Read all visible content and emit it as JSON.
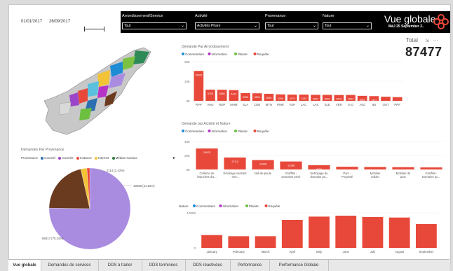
{
  "date_range": {
    "start": "01/01/2017",
    "end": "26/09/2017"
  },
  "filters": [
    {
      "label": "Arrondissement/Service",
      "value": "Tout"
    },
    {
      "label": "Activité",
      "value": "Activités Phare"
    },
    {
      "label": "Provenance",
      "value": "Tout"
    },
    {
      "label": "Nature",
      "value": "Tout"
    }
  ],
  "header": {
    "title": "Vue globale",
    "subtitle": "MàJ 25 September 2.."
  },
  "kpi": {
    "label": "Total",
    "value": "87477"
  },
  "colors": {
    "commentaire": "#1f8dd6",
    "information": "#b533c7",
    "plainte": "#6cbf3f",
    "requete": "#e8483a",
    "courriel": "#2b6fb0",
    "courrier": "#9d45c9",
    "instance": "#e8483a",
    "internet": "#f2c335",
    "medias": "#2d7b3a",
    "telephone": "#a98be0",
    "autre": "#6b3b1f"
  },
  "chart_data": [
    {
      "type": "bar",
      "title": "Demande Par Arrondissement",
      "legend": [
        "Commentaire",
        "Information",
        "Plainte",
        "Requête"
      ],
      "categories": [
        "RPP",
        "AHU",
        "RDP",
        "MHM",
        "SLA",
        "CDN",
        "MTN",
        "PMR",
        "VSP",
        "LAC",
        "LAS",
        "SLE",
        "VER",
        "S-O",
        "ANJ",
        "IBI",
        "OUT",
        "PRF"
      ],
      "values": [
        15263,
        5705,
        5660,
        5474,
        3939,
        3844,
        3594,
        3294,
        3179,
        3182,
        3064,
        3044,
        2976,
        2994,
        2551,
        2401,
        2100,
        1900
      ],
      "data_labels": [
        "15263",
        "5705",
        "5660",
        "5474",
        "3939",
        "3844",
        "3594",
        "3294",
        "3179",
        "3182",
        "3064",
        "3044",
        "2976",
        "2994",
        "2551",
        "2401",
        "",
        ""
      ],
      "yticks": [
        "20K",
        "10K",
        "0K"
      ],
      "ylim": [
        0,
        20000
      ]
    },
    {
      "type": "bar",
      "title": "Demande par Activité et Nature",
      "legend": [
        "Commentaire",
        "Information",
        "Plainte",
        "Requête"
      ],
      "categories": [
        "Collecte de branches d'a...",
        "Éclairage existant - Em...",
        "Nid-de-poule",
        "Graffitis - Domaine privé",
        "Nettoyage du domaine pu...",
        "Parc - Propreté",
        "Mobilier urbain",
        "Mobilier de parc",
        "Graffitis - Domaine pu..."
      ],
      "values": [
        29975,
        17112,
        13436,
        11388,
        6115,
        3900,
        3500,
        3300,
        2900
      ],
      "data_labels": [
        "29975",
        "17112",
        "13436",
        "11388",
        "6115",
        "",
        "",
        "",
        ""
      ],
      "yticks": [
        "40K",
        "20K",
        "0K"
      ],
      "ylim": [
        0,
        40000
      ]
    },
    {
      "type": "pie",
      "title": "Demandes Par Provenance",
      "legend_title": "Provenance",
      "legend": [
        "Courriel",
        "Courrier",
        "Instance",
        "Internet",
        "Médias sociaux"
      ],
      "slices": [
        {
          "value": 65817,
          "pct": 75.24,
          "color": "#a98be0"
        },
        {
          "value": 18568,
          "pct": 21.16,
          "color": "#6b3b1f"
        },
        {
          "value": 2114,
          "pct": 2.42,
          "color": "#f2c335"
        },
        {
          "value": 978,
          "pct": 1.18,
          "color": "#e8483a"
        }
      ],
      "data_labels": [
        "65817 (75.24%)",
        "18568 (21.16%)",
        "2114 (2.42%)"
      ]
    },
    {
      "type": "bar",
      "title": "",
      "legend_title": "Nature",
      "legend": [
        "Commentaire",
        "Information",
        "Plainte",
        "Requête"
      ],
      "categories": [
        "January",
        "February",
        "March",
        "April",
        "May",
        "June",
        "July",
        "August",
        "September"
      ],
      "values": [
        5500,
        5000,
        5000,
        12000,
        13400,
        13800,
        13200,
        13000,
        10200
      ],
      "yticks": [
        "10000",
        "0"
      ],
      "ylim": [
        0,
        15000
      ]
    }
  ],
  "tabs": [
    "Vue globale",
    "Demandes de services",
    "DDS à traiter",
    "DDS terminées",
    "DDS réactivées",
    "Performance",
    "Performance Globale"
  ]
}
